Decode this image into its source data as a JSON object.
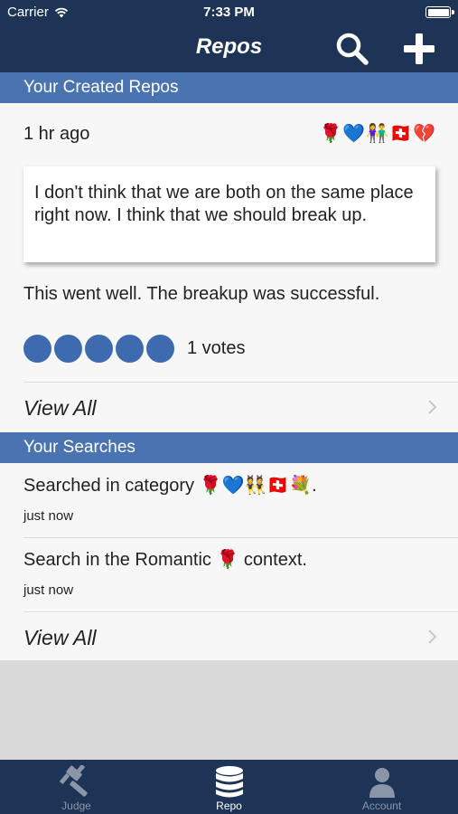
{
  "status_bar": {
    "carrier": "Carrier",
    "time": "7:33 PM"
  },
  "nav": {
    "title": "Repos",
    "search_icon": "search-icon",
    "add_icon": "plus-icon"
  },
  "created_section": {
    "header": "Your Created Repos",
    "time_ago": "1 hr ago",
    "emojis": "🌹💙👫🇨🇭💔",
    "quote": "I don't think that we are both on the same place right now. I think that we should break up.",
    "result": "This went well. The breakup was successful.",
    "rating": {
      "filled": 5,
      "total": 5,
      "votes_label": "1 votes"
    },
    "view_all": "View All"
  },
  "searches_section": {
    "header": "Your Searches",
    "items": [
      {
        "text": "Searched in category 🌹💙👯🇨🇭💐.",
        "time": "just now"
      },
      {
        "text": "Search in the Romantic 🌹 context.",
        "time": "just now"
      }
    ],
    "view_all": "View All"
  },
  "tab_bar": {
    "tabs": [
      {
        "label": "Judge",
        "icon": "gavel-icon",
        "active": false
      },
      {
        "label": "Repo",
        "icon": "database-icon",
        "active": true
      },
      {
        "label": "Account",
        "icon": "user-icon",
        "active": false
      }
    ]
  },
  "colors": {
    "nav": "#1d3456",
    "section_header": "#4a73b2",
    "rating_dot": "#3e6bb0",
    "card_bg": "#f7f7f7",
    "empty_bg": "#d9d9d9"
  }
}
